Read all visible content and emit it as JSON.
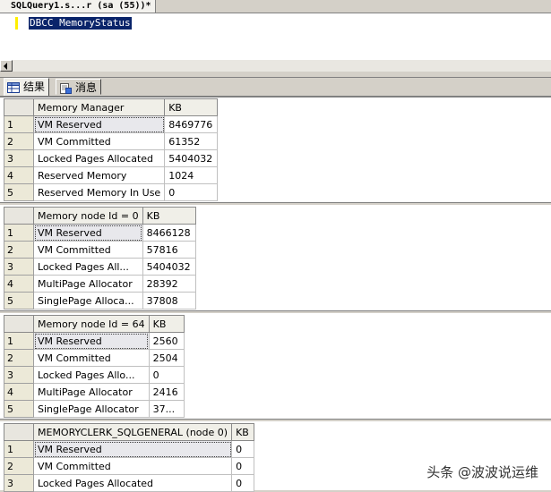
{
  "document": {
    "tab_title": "SQLQuery1.s...r (sa (55))*"
  },
  "editor": {
    "code_line": "DBCC MemoryStatus"
  },
  "result_tabs": [
    {
      "label": "结果",
      "icon": "grid-icon"
    },
    {
      "label": "消息",
      "icon": "messages-icon"
    }
  ],
  "grids": [
    {
      "headers": [
        "Memory Manager",
        "KB"
      ],
      "rows": [
        [
          "1",
          "VM Reserved",
          "8469776"
        ],
        [
          "2",
          "VM Committed",
          "61352"
        ],
        [
          "3",
          "Locked Pages Allocated",
          "5404032"
        ],
        [
          "4",
          "Reserved Memory",
          "1024"
        ],
        [
          "5",
          "Reserved Memory In Use",
          "0"
        ]
      ]
    },
    {
      "headers": [
        "Memory node Id = 0",
        "KB"
      ],
      "rows": [
        [
          "1",
          "VM Reserved",
          "8466128"
        ],
        [
          "2",
          "VM Committed",
          "57816"
        ],
        [
          "3",
          "Locked Pages All...",
          "5404032"
        ],
        [
          "4",
          "MultiPage Allocator",
          "28392"
        ],
        [
          "5",
          "SinglePage Alloca...",
          "37808"
        ]
      ]
    },
    {
      "headers": [
        "Memory node Id = 64",
        "KB"
      ],
      "rows": [
        [
          "1",
          "VM Reserved",
          "2560"
        ],
        [
          "2",
          "VM Committed",
          "2504"
        ],
        [
          "3",
          "Locked Pages Allo...",
          "0"
        ],
        [
          "4",
          "MultiPage Allocator",
          "2416"
        ],
        [
          "5",
          "SinglePage Allocator",
          "37..."
        ]
      ]
    },
    {
      "headers": [
        "MEMORYCLERK_SQLGENERAL (node 0)",
        "KB"
      ],
      "rows": [
        [
          "1",
          "VM Reserved",
          "0"
        ],
        [
          "2",
          "VM Committed",
          "0"
        ],
        [
          "3",
          "Locked Pages Allocated",
          "0"
        ]
      ]
    }
  ],
  "watermark": "头条 @波波说运维"
}
